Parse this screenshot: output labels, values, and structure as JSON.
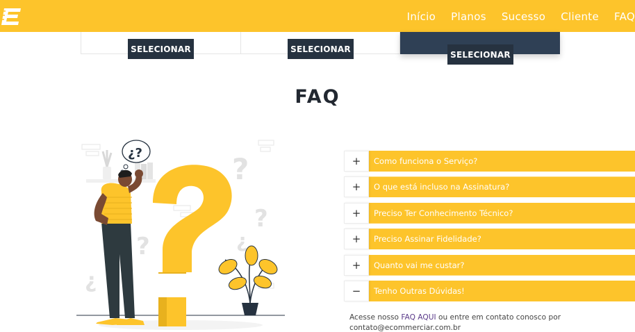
{
  "header": {
    "logo_icon": "ecommerce-e-logo",
    "brand_color": "#fdc42b",
    "nav": [
      "Início",
      "Planos",
      "Sucesso",
      "Cliente",
      "FAQ"
    ]
  },
  "plans": {
    "select_label_1": "SELECIONAR",
    "select_label_2": "SELECIONAR",
    "select_label_3": "SELECIONAR"
  },
  "faq": {
    "title": "FAQ",
    "items": [
      {
        "toggle": "+",
        "label": "Como funciona o Serviço?"
      },
      {
        "toggle": "+",
        "label": "O que está incluso na Assinatura?"
      },
      {
        "toggle": "+",
        "label": "Preciso Ter Conhecimento Técnico?"
      },
      {
        "toggle": "+",
        "label": "Preciso Assinar Fidelidade?"
      },
      {
        "toggle": "+",
        "label": "Quanto vai me custar?"
      },
      {
        "toggle": "−",
        "label": "Tenho Outras Dúvidas!"
      }
    ],
    "answer": {
      "prefix": "Acesse nosso ",
      "link": "FAQ AQUI",
      "suffix": " ou entre em contato conosco por",
      "email": "contato@ecommerciar.com.br"
    }
  },
  "colors": {
    "accent": "#fdc42b",
    "dark": "#263240",
    "featured": "#2f4055"
  }
}
